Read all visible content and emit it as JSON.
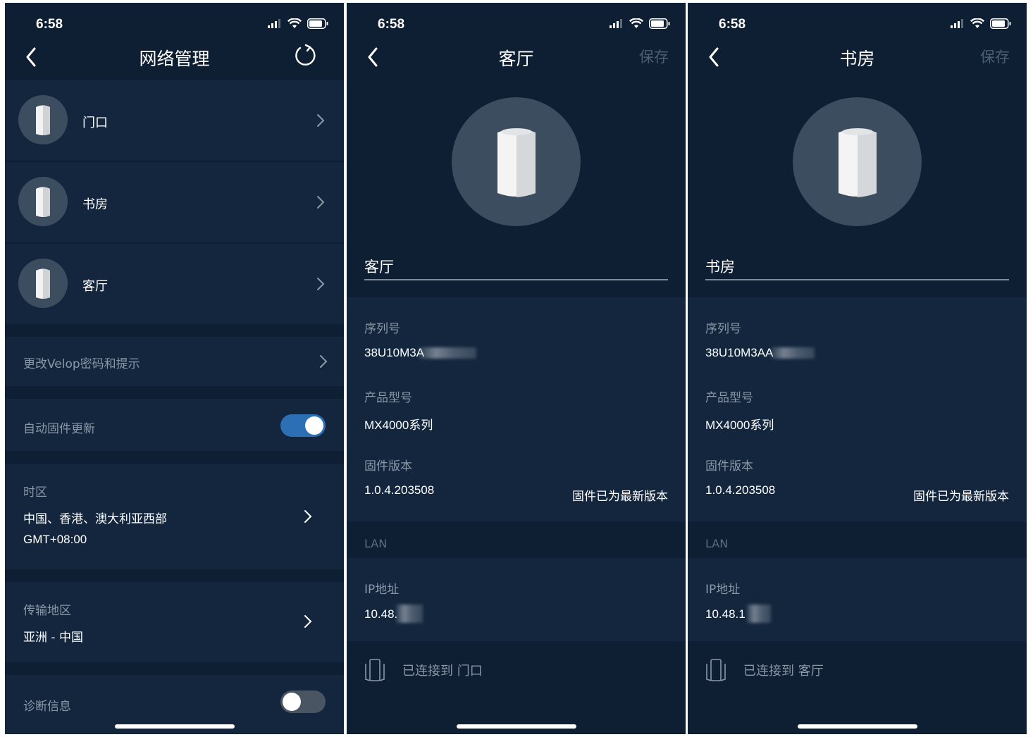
{
  "colors": {
    "background": "#0e1e33",
    "section": "#13263d",
    "muted_text": "#8a97a6",
    "toggle_on": "#2c6fb5",
    "toggle_off": "#4a5563",
    "disabled_action": "#4b5e73"
  },
  "status": {
    "time": "6:58"
  },
  "screen1": {
    "title": "网络管理",
    "refresh_icon": "refresh-icon",
    "nodes": [
      {
        "name": "门口"
      },
      {
        "name": "书房"
      },
      {
        "name": "客厅"
      }
    ],
    "change_password": "更改Velop密码和提示",
    "auto_update": {
      "label": "自动固件更新",
      "enabled": true
    },
    "timezone": {
      "label": "时区",
      "value": "中国、香港、澳大利亚西部",
      "offset": "GMT+08:00"
    },
    "region": {
      "label": "传输地区",
      "value": "亚洲 - 中国"
    },
    "diagnostics": {
      "label": "诊断信息",
      "enabled": false
    }
  },
  "screen2": {
    "title": "客厅",
    "save_label": "保存",
    "name_value": "客厅",
    "serial": {
      "label": "序列号",
      "value": "38U10M3A"
    },
    "model": {
      "label": "产品型号",
      "value": "MX4000系列"
    },
    "firmware": {
      "label": "固件版本",
      "value": "1.0.4.203508",
      "status": "固件已为最新版本"
    },
    "lan_label": "LAN",
    "ip": {
      "label": "IP地址",
      "value": "10.48."
    },
    "connected_to": "已连接到 门口"
  },
  "screen3": {
    "title": "书房",
    "save_label": "保存",
    "name_value": "书房",
    "serial": {
      "label": "序列号",
      "value": "38U10M3AA"
    },
    "model": {
      "label": "产品型号",
      "value": "MX4000系列"
    },
    "firmware": {
      "label": "固件版本",
      "value": "1.0.4.203508",
      "status": "固件已为最新版本"
    },
    "lan_label": "LAN",
    "ip": {
      "label": "IP地址",
      "value": "10.48.1"
    },
    "connected_to": "已连接到 客厅"
  }
}
